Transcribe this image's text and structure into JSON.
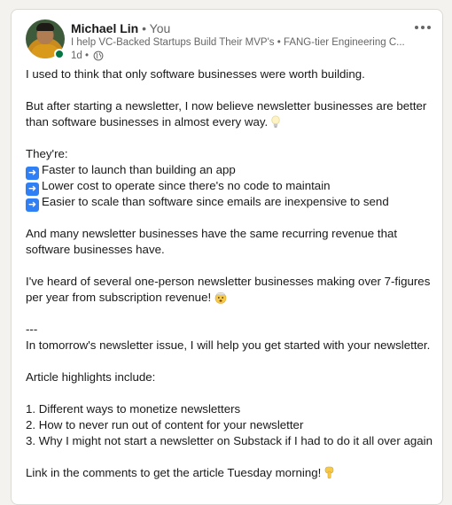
{
  "author": {
    "name": "Michael Lin",
    "separator": "•",
    "you_label": "You",
    "headline": "I help VC-Backed Startups Build Their MVP's • FANG-tier Engineering C...",
    "time": "1d •"
  },
  "post": {
    "intro": "I used to think that only software businesses were worth building.",
    "p2_line1": "But after starting a newsletter, I now believe newsletter businesses are better",
    "p2_line2": "than software businesses in almost every way.",
    "theyre": "They're:",
    "bullets": [
      "Faster to launch than building an app",
      "Lower cost to operate since there's no code to maintain",
      "Easier to scale than software since emails are inexpensive to send"
    ],
    "p4_line1": "And many newsletter businesses have the same recurring revenue that",
    "p4_line2": "software businesses have.",
    "p5_line1": "I've heard of several one-person newsletter businesses making over 7-figures",
    "p5_line2": "per year from subscription revenue!",
    "divider": "---",
    "tomorrow": "In tomorrow's newsletter issue, I will help you get started with your newsletter.",
    "highlights_intro": "Article highlights include:",
    "highlights": [
      "1. Different ways to monetize newsletters",
      "2. How to never run out of content for your newsletter",
      "3. Why I might not start a newsletter on Substack if I had to do it all over again"
    ],
    "cta": "Link in the comments to get the article Tuesday morning!"
  },
  "icons": {
    "bulb": "lightbulb-icon",
    "mind_blown": "mind-blown-emoji-icon",
    "point_down": "pointing-down-emoji-icon",
    "arrow": "right-arrow-box-icon",
    "globe": "globe-icon",
    "more": "more-options-icon"
  },
  "colors": {
    "online": "#057642",
    "arrow_box": "#2f7ff5",
    "text": "#191919",
    "muted": "#666666"
  }
}
